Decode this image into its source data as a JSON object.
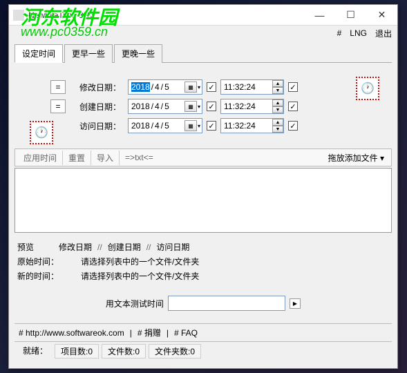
{
  "watermark": {
    "line1": "河东软件园",
    "line2": "www.pc0359.cn"
  },
  "titlebar": {
    "title": "NewFileTime 3.13"
  },
  "wincontrols": {
    "min": "—",
    "max": "☐",
    "close": "✕"
  },
  "menubar": {
    "hash": "#",
    "lng": "LNG",
    "exit": "退出"
  },
  "tabs": {
    "set": "设定时间",
    "earlier": "更早一些",
    "later": "更晚一些"
  },
  "rows": {
    "eq": "=",
    "modify": {
      "label": "修改日期：",
      "year": "2018",
      "sep1": "/",
      "mon": " 4",
      "sep2": "/",
      "day": " 5",
      "time": "11:32:24"
    },
    "create": {
      "label": "创建日期：",
      "year": "2018",
      "sep1": "/",
      "mon": " 4",
      "sep2": "/",
      "day": " 5",
      "time": "11:32:24"
    },
    "access": {
      "label": "访问日期：",
      "year": "2018",
      "sep1": "/",
      "mon": " 4",
      "sep2": "/",
      "day": " 5",
      "time": "11:32:24"
    },
    "check": "✓",
    "cal": "▦",
    "up": "▲",
    "dn": "▼",
    "darrow": "▾"
  },
  "toolbar": {
    "apply": "应用时间",
    "reset": "重置",
    "import": "导入",
    "txt": "=>txt<=",
    "drop": "拖放添加文件  ▾"
  },
  "preview": {
    "header": "预览",
    "modify": "修改日期",
    "create": "创建日期",
    "access": "访问日期",
    "ds": "//"
  },
  "info": {
    "orig_label": "原始时间：",
    "new_label": "新的时间：",
    "msg": "请选择列表中的一个文件/文件夹"
  },
  "test": {
    "label": "用文本测试时间",
    "go": "▶"
  },
  "footer": {
    "l1": "# http://www.softwareok.com",
    "l2": "# 捐赠",
    "l3": "# FAQ"
  },
  "status": {
    "ready": "就绪：",
    "items": "项目数:0",
    "files": "文件数:0",
    "folders": "文件夹数:0"
  }
}
